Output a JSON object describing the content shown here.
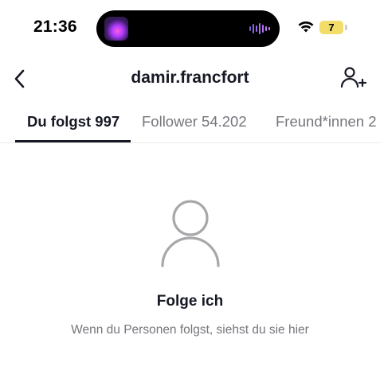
{
  "status_bar": {
    "time": "21:36",
    "battery_level": "7",
    "icons": [
      "now-playing-app-icon",
      "audio-waveform-icon",
      "wifi-icon",
      "battery-icon"
    ]
  },
  "header": {
    "title": "damir.francfort",
    "back_icon": "chevron-left-icon",
    "add_icon": "add-person-icon"
  },
  "tabs": [
    {
      "label": "Du folgst 997",
      "active": true
    },
    {
      "label": "Follower 54.202",
      "active": false
    },
    {
      "label": "Freund*innen 2",
      "active": false
    }
  ],
  "empty_state": {
    "icon": "person-outline-icon",
    "title": "Folge ich",
    "subtitle": "Wenn du Personen folgst, siehst du sie hier"
  },
  "colors": {
    "text_primary": "#161823",
    "text_secondary": "#75767c",
    "divider": "#eaeaea",
    "battery": "#f2dd6a",
    "icon_gray": "#a8a8ab"
  }
}
